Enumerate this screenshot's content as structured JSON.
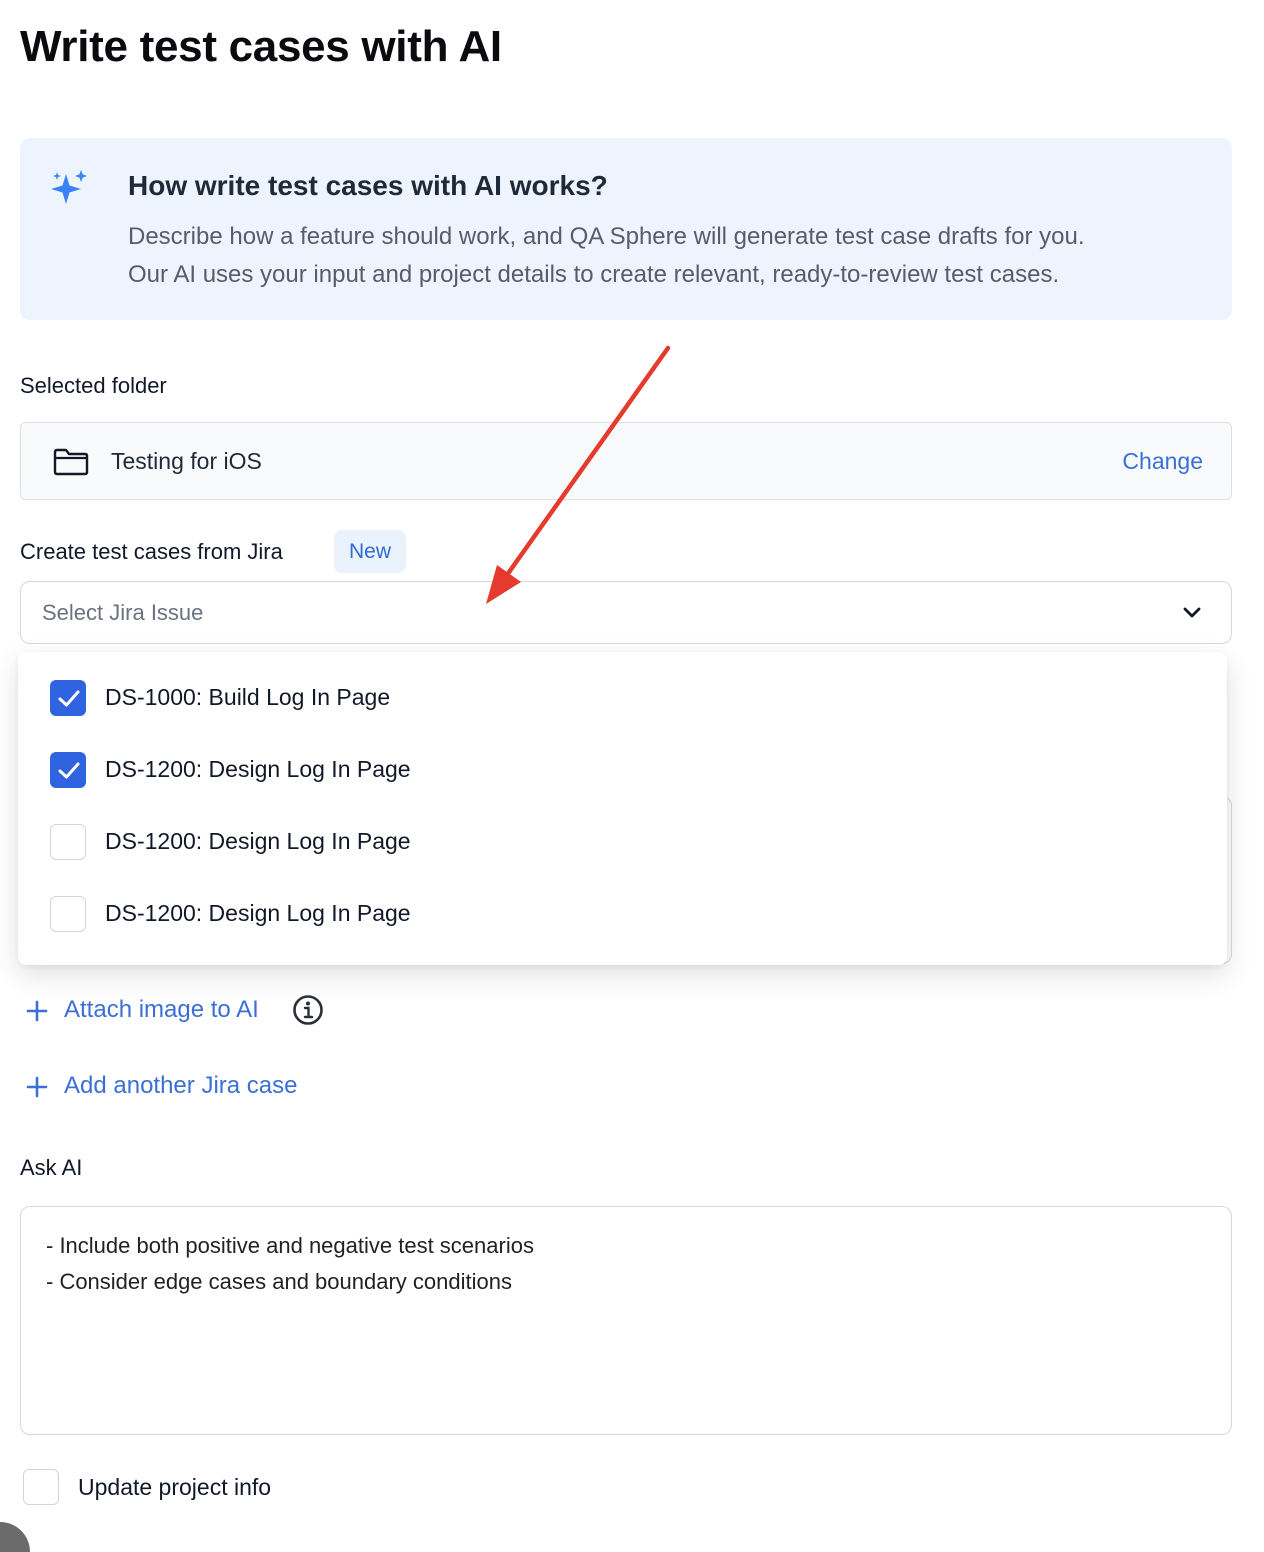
{
  "page": {
    "title": "Write test cases with AI"
  },
  "info": {
    "icon": "sparkles-icon",
    "heading": "How write test cases with AI works?",
    "line1": "Describe how a feature should work, and QA Sphere will generate test case drafts for you.",
    "line2": "Our AI uses your input and project details to create relevant, ready-to-review test cases."
  },
  "folder": {
    "label": "Selected folder",
    "name": "Testing for iOS",
    "change_label": "Change"
  },
  "jira": {
    "label": "Create test cases from Jira",
    "badge": "New",
    "placeholder": "Select Jira Issue",
    "options": [
      {
        "label": "DS-1000: Build Log In Page",
        "checked": true
      },
      {
        "label": "DS-1200: Design Log In Page",
        "checked": true
      },
      {
        "label": "DS-1200: Design Log In Page",
        "checked": false
      },
      {
        "label": "DS-1200: Design Log In Page",
        "checked": false
      }
    ]
  },
  "actions": {
    "attach_label": "Attach image to AI",
    "add_jira_label": "Add another Jira case"
  },
  "ask": {
    "label": "Ask AI",
    "line1": "- Include both positive and negative test scenarios",
    "line2": "- Consider edge cases and boundary conditions"
  },
  "project": {
    "label": "Update project info",
    "checked": false
  },
  "colors": {
    "accent": "#2f63e0",
    "link": "#3b6fd6",
    "info_bg": "#eef4fd",
    "annotation": "#e53b2e"
  }
}
